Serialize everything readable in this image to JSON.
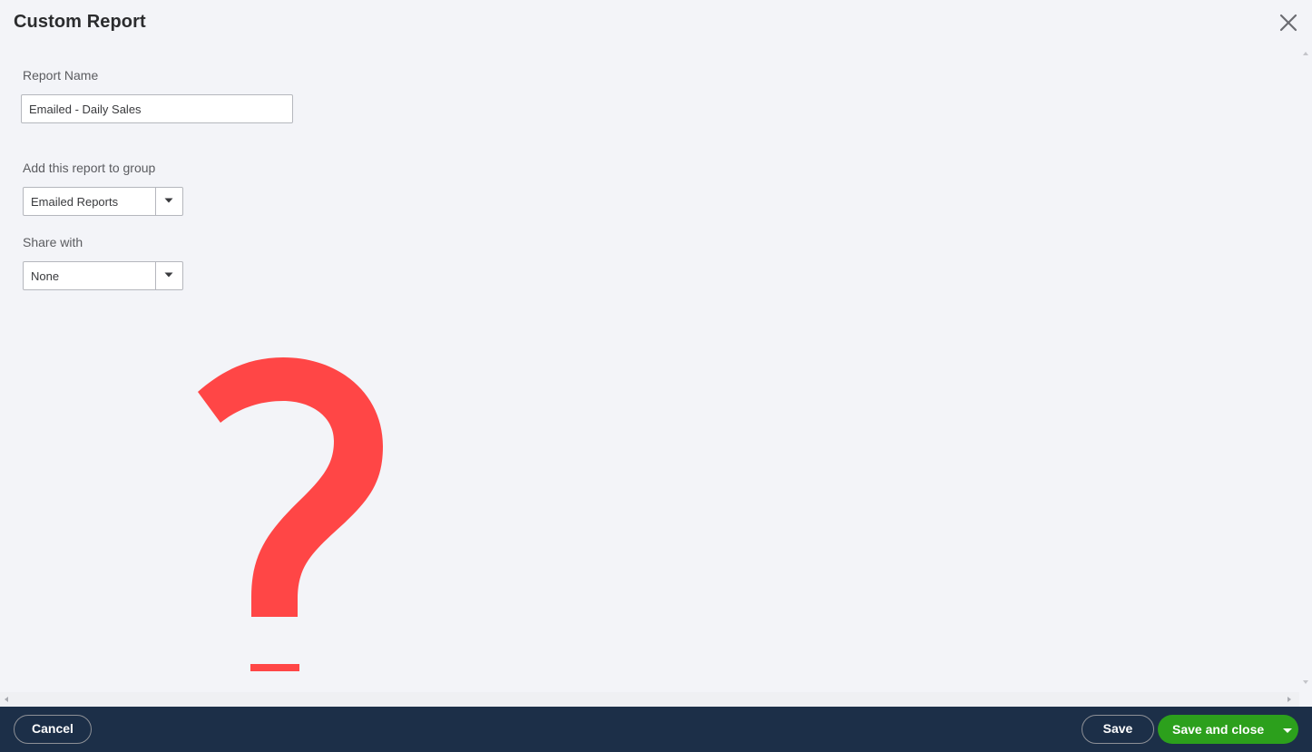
{
  "dialog": {
    "title": "Custom Report",
    "close_icon": "close-icon"
  },
  "form": {
    "report_name_label": "Report Name",
    "report_name_value": "Emailed - Daily Sales",
    "group_label": "Add this report to group",
    "group_selected": "Emailed Reports",
    "share_label": "Share with",
    "share_selected": "None"
  },
  "overlay": {
    "icon": "question-mark-icon",
    "color": "#ff4646"
  },
  "footer": {
    "cancel_label": "Cancel",
    "save_label": "Save",
    "save_close_label": "Save and close"
  },
  "colors": {
    "footer_bg": "#1c2f48",
    "primary_green": "#2ca01c",
    "page_bg": "#f3f4f8"
  }
}
